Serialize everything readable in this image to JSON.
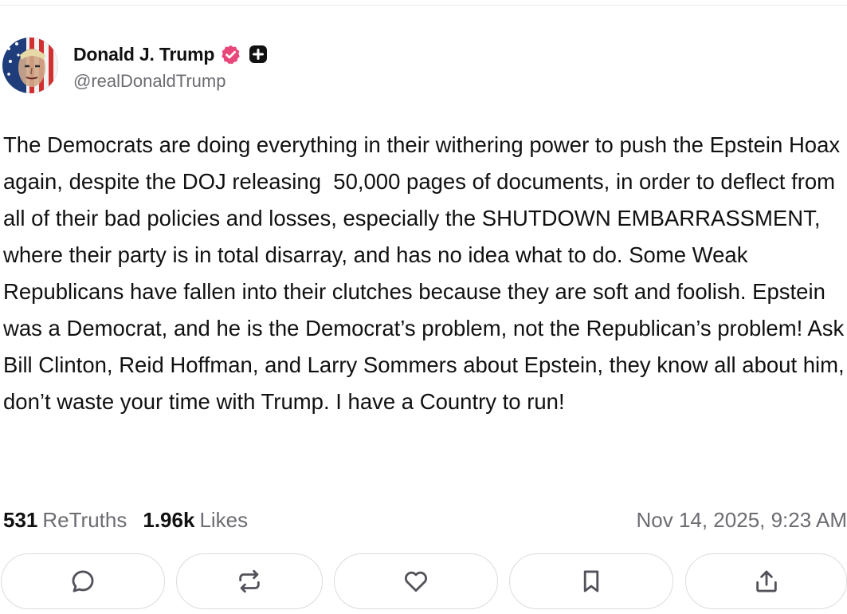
{
  "author": {
    "display_name": "Donald J. Trump",
    "handle": "@realDonaldTrump",
    "verified_badge_color": "#e8477a"
  },
  "post": {
    "text": "The Democrats are doing everything in their withering power to push the Epstein Hoax again, despite the DOJ releasing  50,000 pages of documents, in order to deflect from all of their bad policies and losses, especially the SHUTDOWN EMBARRASSMENT, where their party is in total disarray, and has no idea what to do. Some Weak Republicans have fallen into their clutches because they are soft and foolish. Epstein was a Democrat, and he is the Democrat’s problem, not the Republican’s problem! Ask Bill Clinton, Reid Hoffman, and Larry Sommers about Epstein, they know all about him, don’t waste your time with Trump. I have a Country to run!"
  },
  "stats": {
    "retruths_count": "531",
    "retruths_label": "ReTruths",
    "likes_count": "1.96k",
    "likes_label": "Likes",
    "timestamp": "Nov 14, 2025, 9:23 AM"
  },
  "actions": [
    {
      "name": "reply-button",
      "icon": "reply-icon"
    },
    {
      "name": "retruth-button",
      "icon": "repost-icon"
    },
    {
      "name": "like-button",
      "icon": "heart-icon"
    },
    {
      "name": "bookmark-button",
      "icon": "bookmark-icon"
    },
    {
      "name": "share-button",
      "icon": "share-icon"
    }
  ],
  "colors": {
    "text_primary": "#111111",
    "text_secondary": "#6c6c72",
    "border": "#dcdce0"
  }
}
